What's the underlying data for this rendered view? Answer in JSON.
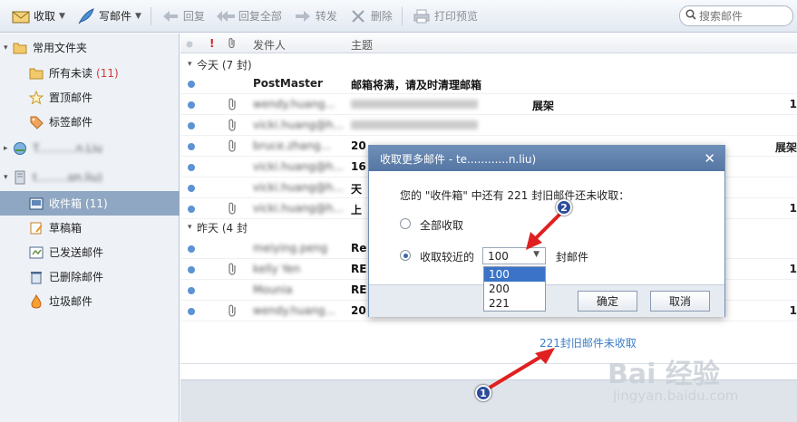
{
  "toolbar": {
    "receive": "收取",
    "compose": "写邮件",
    "reply": "回复",
    "reply_all": "回复全部",
    "forward": "转发",
    "delete": "删除",
    "print_preview": "打印预览",
    "search_placeholder": "搜索邮件"
  },
  "sidebar": {
    "common_folders": "常用文件夹",
    "all_unread": "所有未读",
    "all_unread_count": "(11)",
    "pinned": "置顶邮件",
    "tagged": "标签邮件",
    "account1": "T...........n.Liu",
    "account2": "t.........on.liu)",
    "inbox": "收件箱",
    "inbox_count": "(11)",
    "drafts": "草稿箱",
    "sent": "已发送邮件",
    "deleted": "已删除邮件",
    "junk": "垃圾邮件"
  },
  "list": {
    "col_sender": "发件人",
    "col_subject": "主题",
    "group_today": "今天 (7 封)",
    "group_yesterday": "昨天 (4 封",
    "rows": [
      {
        "sender": "PostMaster",
        "subject": "邮箱将满，请及时清理邮箱",
        "clip": false,
        "mark": ""
      },
      {
        "sender": "wendy.huang...",
        "subject": "展架",
        "clip": true,
        "mark": "1"
      },
      {
        "sender": "vicki.huang@h...",
        "subject": "",
        "clip": true,
        "mark": ""
      },
      {
        "sender": "bruce.zhang...",
        "subject": "20",
        "clip": true,
        "mark": "展架"
      },
      {
        "sender": "vicki.huang@h...",
        "subject": "16",
        "clip": false,
        "mark": ""
      },
      {
        "sender": "vicki.huang@h...",
        "subject": "天",
        "clip": false,
        "mark": ""
      },
      {
        "sender": "vicki.huang@h...",
        "subject": "上",
        "clip": true,
        "mark": "1"
      },
      {
        "sender": "meiying.peng",
        "subject": "Re",
        "clip": false,
        "mark": ""
      },
      {
        "sender": "kelly Yen",
        "subject": "RE",
        "clip": true,
        "mark": "1"
      },
      {
        "sender": "Mounia",
        "subject": "RE",
        "clip": false,
        "mark": ""
      },
      {
        "sender": "wendy.huang...",
        "subject": "20",
        "clip": true,
        "mark": "1"
      }
    ],
    "old_mail_link": "221封旧邮件未收取"
  },
  "dialog": {
    "title": "收取更多邮件 - te............n.liu)",
    "message": "您的 \"收件箱\" 中还有 221 封旧邮件还未收取：",
    "option_all": "全部收取",
    "option_recent": "收取较近的",
    "selected_count": "100",
    "unit": "封邮件",
    "ok": "确定",
    "cancel": "取消",
    "dropdown_options": [
      "100",
      "200",
      "221"
    ]
  },
  "annotations": {
    "badge1": "1",
    "badge2": "2",
    "arrow_color": "#e02020"
  },
  "watermark": {
    "line1": "Bai 经验",
    "line2": "jingyan.baidu.com"
  }
}
